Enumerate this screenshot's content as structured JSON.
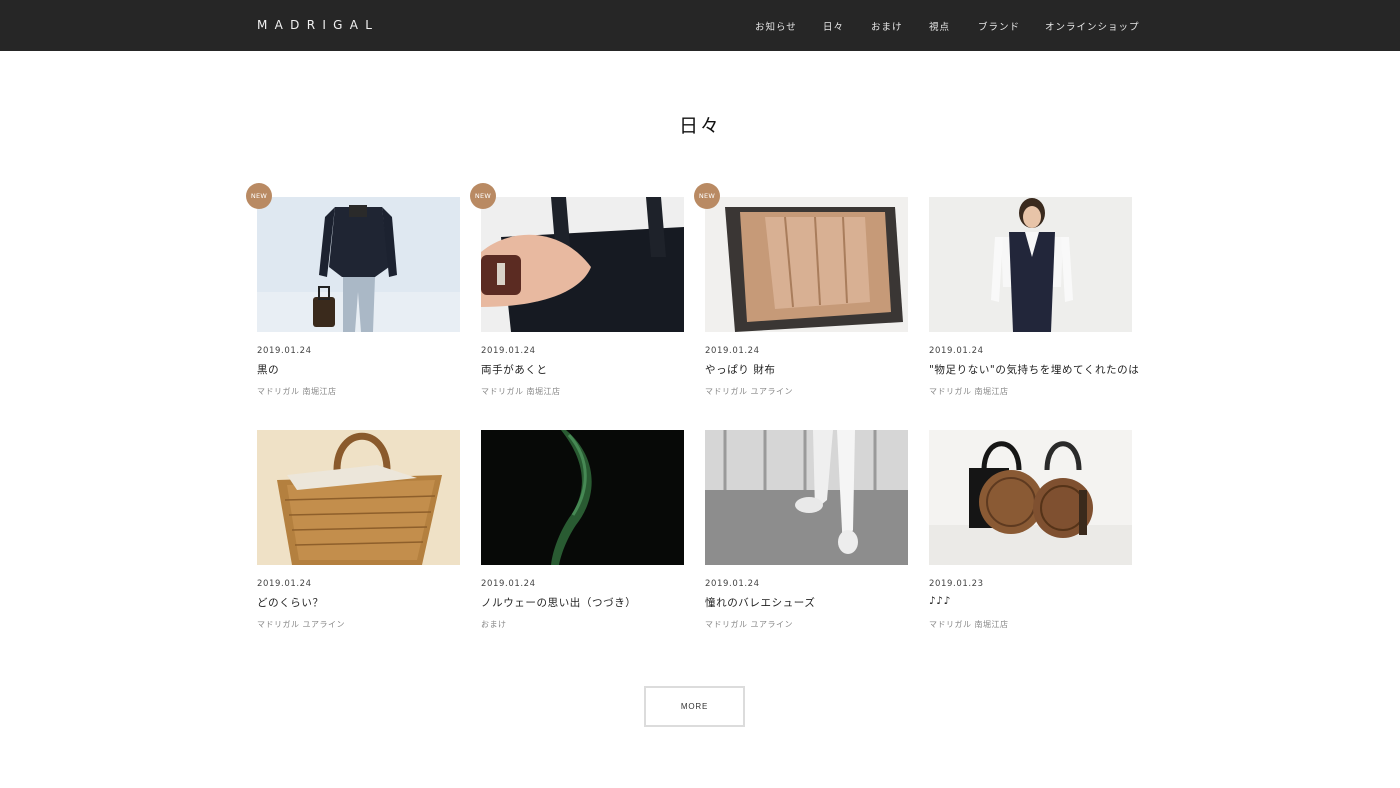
{
  "header": {
    "logo": "MADRIGAL",
    "nav": [
      {
        "label": "お知らせ"
      },
      {
        "label": "日々"
      },
      {
        "label": "おまけ"
      },
      {
        "label": "視点"
      },
      {
        "label": "ブランド"
      },
      {
        "label": "オンラインショップ"
      }
    ]
  },
  "page": {
    "title": "日々"
  },
  "posts": [
    {
      "badge": "NEW",
      "date": "2019.01.24",
      "title": "黒の",
      "author": "マドリガル 南堀江店",
      "image": "man-dark-jacket-photo"
    },
    {
      "badge": "NEW",
      "date": "2019.01.24",
      "title": "両手があくと",
      "author": "マドリガル 南堀江店",
      "image": "hand-tote-bag-photo"
    },
    {
      "badge": "NEW",
      "date": "2019.01.24",
      "title": "やっぱり 財布",
      "author": "マドリガル ユアライン",
      "image": "leather-wallet-photo"
    },
    {
      "badge": "",
      "date": "2019.01.24",
      "title": "\"物足りない\"の気持ちを埋めてくれたのは",
      "author": "マドリガル 南堀江店",
      "image": "woman-navy-vest-photo"
    },
    {
      "badge": "",
      "date": "2019.01.24",
      "title": "どのくらい？",
      "author": "マドリガル ユアライン",
      "image": "wicker-basket-photo"
    },
    {
      "badge": "",
      "date": "2019.01.24",
      "title": "ノルウェーの思い出（つづき）",
      "author": "おまけ",
      "image": "aurora-photo"
    },
    {
      "badge": "",
      "date": "2019.01.24",
      "title": "憧れのバレエシューズ",
      "author": "マドリガル ユアライン",
      "image": "ballet-pointe-photo"
    },
    {
      "badge": "",
      "date": "2019.01.23",
      "title": "♪♪♪",
      "author": "マドリガル 南堀江店",
      "image": "round-bags-photo"
    }
  ],
  "more_label": "MORE",
  "colors": {
    "header_bg": "#262626",
    "badge": "#b98a63"
  }
}
